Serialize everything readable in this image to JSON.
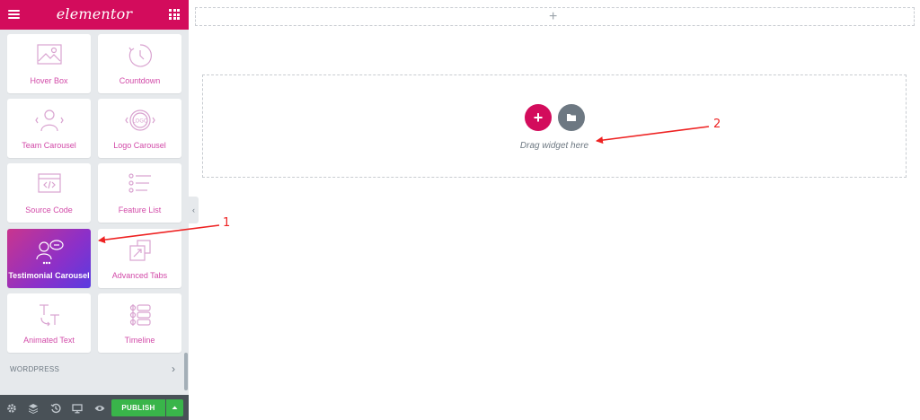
{
  "sidebar": {
    "logo": "elementor",
    "widgets": [
      {
        "label": "Hover Box",
        "icon": "image-icon"
      },
      {
        "label": "Countdown",
        "icon": "clock-icon"
      },
      {
        "label": "Team Carousel",
        "icon": "person-icon"
      },
      {
        "label": "Logo Carousel",
        "icon": "logo-badge-icon"
      },
      {
        "label": "Source Code",
        "icon": "code-window-icon"
      },
      {
        "label": "Feature List",
        "icon": "list-icon"
      },
      {
        "label": "Testimonial Carousel",
        "icon": "testimonial-icon",
        "active": true
      },
      {
        "label": "Advanced Tabs",
        "icon": "tabs-icon"
      },
      {
        "label": "Animated Text",
        "icon": "text-icon"
      },
      {
        "label": "Timeline",
        "icon": "timeline-icon"
      }
    ],
    "section_label": "WORDPRESS"
  },
  "footer": {
    "publish_label": "PUBLISH",
    "icons": [
      "settings-icon",
      "layers-icon",
      "history-icon",
      "responsive-icon",
      "preview-icon"
    ]
  },
  "canvas": {
    "drag_text": "Drag widget here"
  },
  "annotations": {
    "label_1": "1",
    "label_2": "2"
  },
  "colors": {
    "brand": "#d30c5c",
    "publish": "#39b54a",
    "widget_text": "#d24aa8",
    "active_gradient_start": "#c9358e",
    "active_gradient_end": "#5a3be0"
  }
}
